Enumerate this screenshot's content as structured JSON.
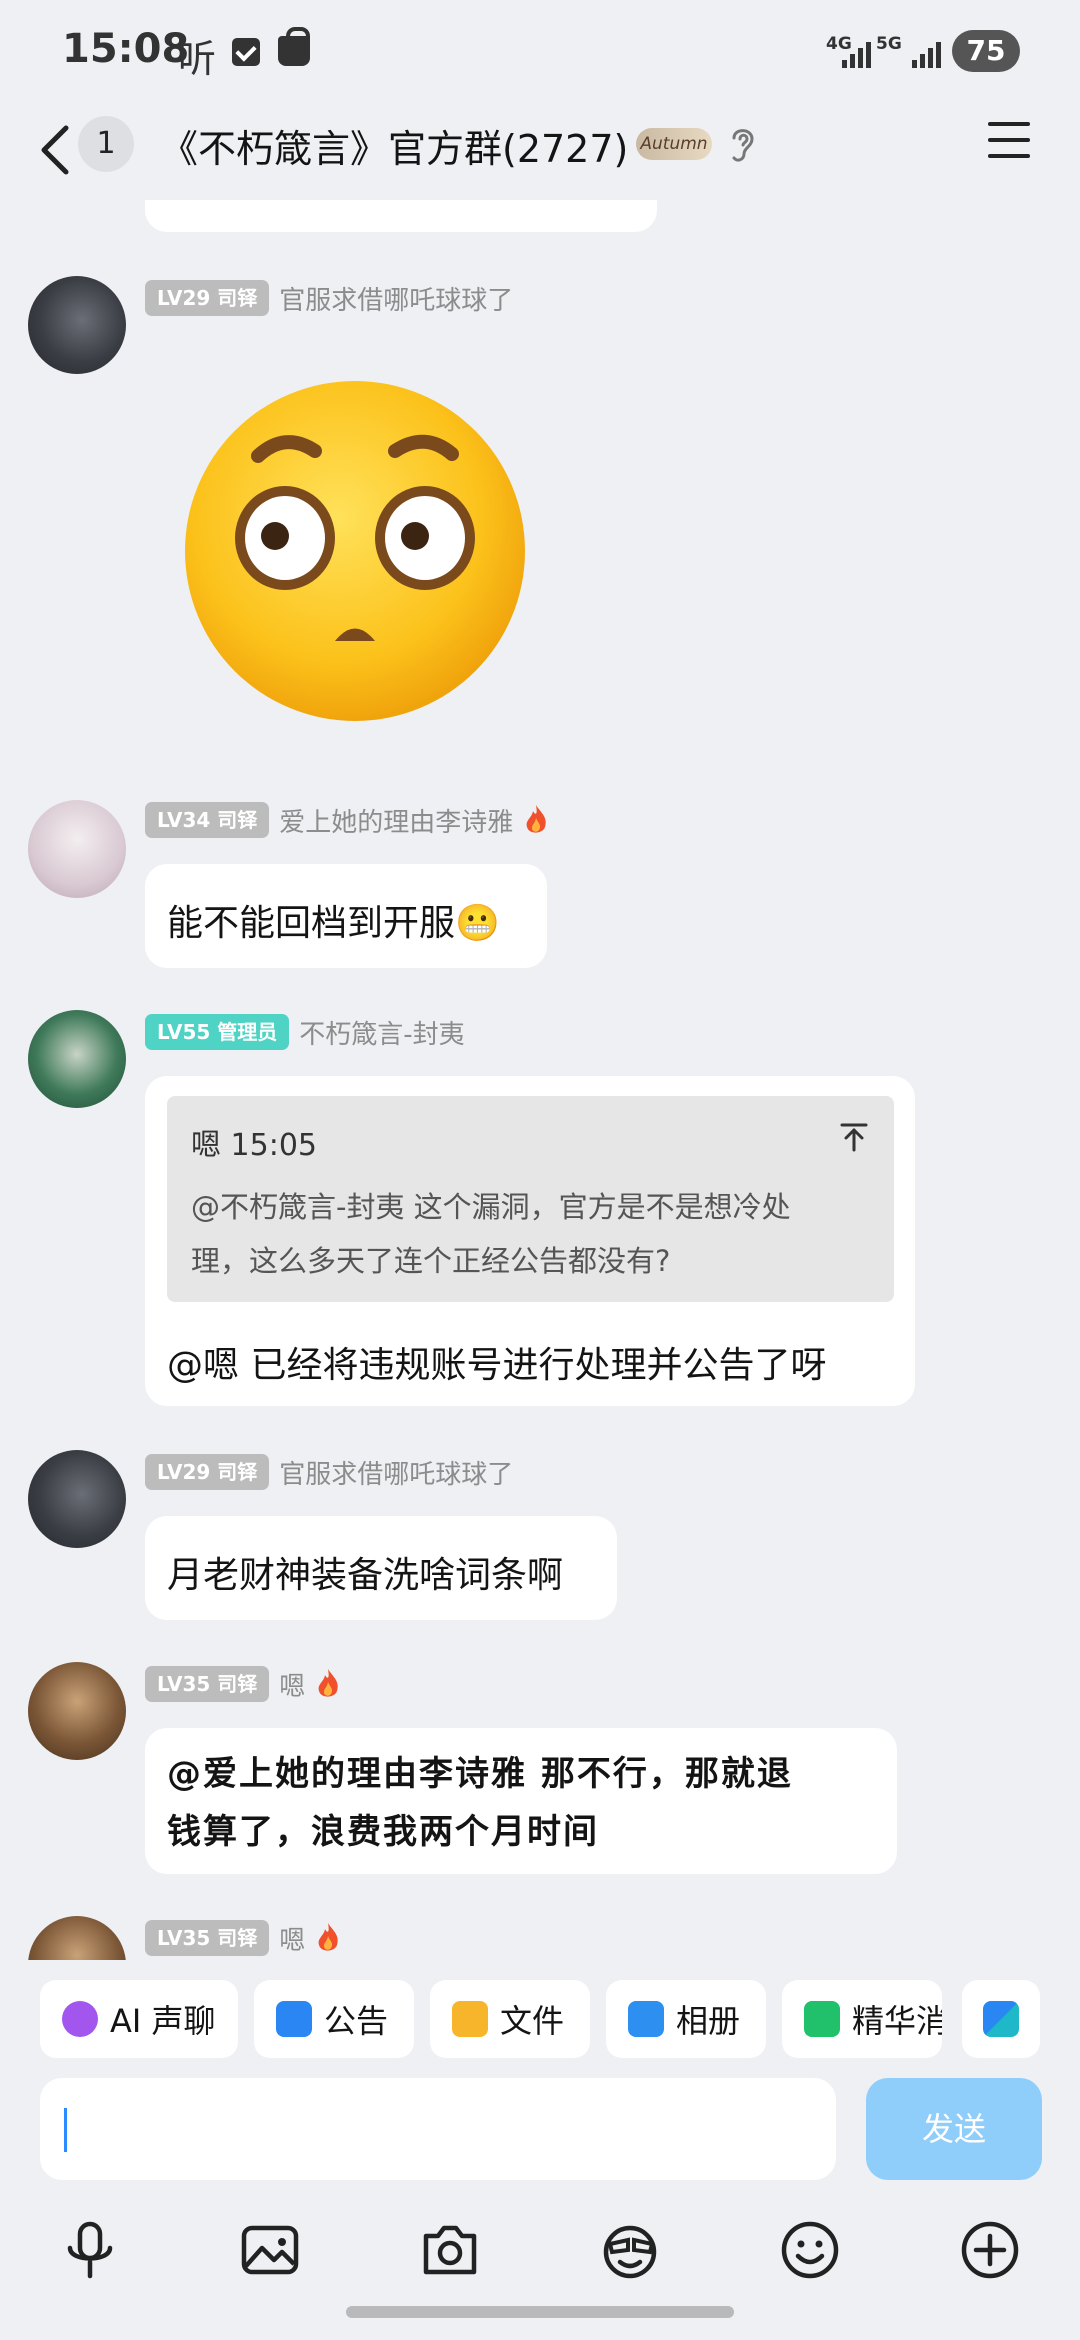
{
  "status_bar": {
    "time": "15:08",
    "extra_glyph": "听",
    "net_4g": "4G",
    "net_5g": "5G",
    "battery": "75"
  },
  "header": {
    "unread_count": "1",
    "title": "《不朽箴言》官方群(2727)",
    "group_tag": "Autumn"
  },
  "messages": [
    {
      "level": "LV29 司铎",
      "nickname": "官服求借哪吒球球了",
      "content_type": "sticker",
      "sticker": "surprised-face-emoji"
    },
    {
      "level": "LV34 司铎",
      "nickname": "爱上她的理由李诗雅",
      "has_fire_badge": true,
      "text": "能不能回档到开服😬"
    },
    {
      "level": "LV55 管理员",
      "nickname": "不朽箴言-封夷",
      "quote": {
        "author_time": "嗯 15:05",
        "line1": "@不朽箴言-封夷 这个漏洞，官方是不是想冷处",
        "line2": "理，这么多天了连个正经公告都没有?"
      },
      "text": "@嗯 已经将违规账号进行处理并公告了呀"
    },
    {
      "level": "LV29 司铎",
      "nickname": "官服求借哪吒球球了",
      "text": "月老财神装备洗啥词条啊"
    },
    {
      "level": "LV35 司铎",
      "nickname": "嗯",
      "has_fire_badge": true,
      "line1": "@爱上她的理由李诗雅 那不行，那就退",
      "line2": "钱算了，浪费我两个月时间"
    },
    {
      "level": "LV35 司铎",
      "nickname": "嗯",
      "has_fire_badge": true
    }
  ],
  "quick_actions": [
    {
      "label": "AI 声聊",
      "icon": "ai-voice-icon"
    },
    {
      "label": "公告",
      "icon": "announcement-icon"
    },
    {
      "label": "文件",
      "icon": "folder-icon"
    },
    {
      "label": "相册",
      "icon": "album-icon"
    },
    {
      "label": "精华消",
      "icon": "essence-icon"
    },
    {
      "label": "",
      "icon": "apps-grid-icon"
    }
  ],
  "input": {
    "value": "",
    "send_label": "发送"
  },
  "toolbar": [
    "microphone-icon",
    "image-icon",
    "camera-icon",
    "sticker-icon",
    "emoji-icon",
    "plus-icon"
  ],
  "colors": {
    "send_button": "#8fcdfb",
    "admin_badge": "#4fd3c4",
    "level_badge": "#bcbcbc",
    "background": "#eef0f4"
  }
}
